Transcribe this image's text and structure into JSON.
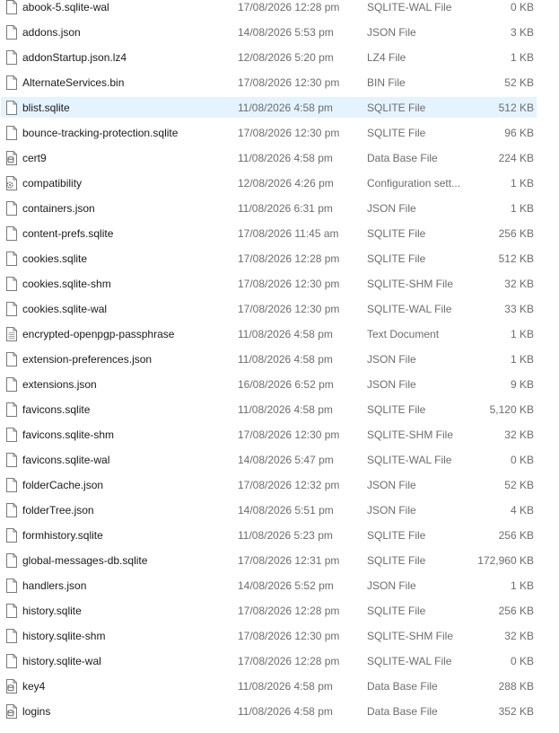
{
  "files": [
    {
      "name": "abook-5.sqlite-wal",
      "date": "17/08/2026 12:28 pm",
      "type": "SQLITE-WAL File",
      "size": "0 KB",
      "icon": "file-icon"
    },
    {
      "name": "addons.json",
      "date": "14/08/2026 5:53 pm",
      "type": "JSON File",
      "size": "3 KB",
      "icon": "file-icon"
    },
    {
      "name": "addonStartup.json.lz4",
      "date": "12/08/2026 5:20 pm",
      "type": "LZ4 File",
      "size": "1 KB",
      "icon": "file-icon"
    },
    {
      "name": "AlternateServices.bin",
      "date": "17/08/2026 12:30 pm",
      "type": "BIN File",
      "size": "52 KB",
      "icon": "file-icon"
    },
    {
      "name": "blist.sqlite",
      "date": "11/08/2026 4:58 pm",
      "type": "SQLITE File",
      "size": "512 KB",
      "icon": "file-icon",
      "selected": true
    },
    {
      "name": "bounce-tracking-protection.sqlite",
      "date": "17/08/2026 12:30 pm",
      "type": "SQLITE File",
      "size": "96 KB",
      "icon": "file-icon"
    },
    {
      "name": "cert9",
      "date": "11/08/2026 4:58 pm",
      "type": "Data Base File",
      "size": "224 KB",
      "icon": "database-file-icon"
    },
    {
      "name": "compatibility",
      "date": "12/08/2026 4:26 pm",
      "type": "Configuration sett...",
      "size": "1 KB",
      "icon": "settings-file-icon"
    },
    {
      "name": "containers.json",
      "date": "11/08/2026 6:31 pm",
      "type": "JSON File",
      "size": "1 KB",
      "icon": "file-icon"
    },
    {
      "name": "content-prefs.sqlite",
      "date": "17/08/2026 11:45 am",
      "type": "SQLITE File",
      "size": "256 KB",
      "icon": "file-icon"
    },
    {
      "name": "cookies.sqlite",
      "date": "17/08/2026 12:28 pm",
      "type": "SQLITE File",
      "size": "512 KB",
      "icon": "file-icon"
    },
    {
      "name": "cookies.sqlite-shm",
      "date": "17/08/2026 12:30 pm",
      "type": "SQLITE-SHM File",
      "size": "32 KB",
      "icon": "file-icon"
    },
    {
      "name": "cookies.sqlite-wal",
      "date": "17/08/2026 12:30 pm",
      "type": "SQLITE-WAL File",
      "size": "33 KB",
      "icon": "file-icon"
    },
    {
      "name": "encrypted-openpgp-passphrase",
      "date": "11/08/2026 4:58 pm",
      "type": "Text Document",
      "size": "1 KB",
      "icon": "text-file-icon"
    },
    {
      "name": "extension-preferences.json",
      "date": "11/08/2026 4:58 pm",
      "type": "JSON File",
      "size": "1 KB",
      "icon": "file-icon"
    },
    {
      "name": "extensions.json",
      "date": "16/08/2026 6:52 pm",
      "type": "JSON File",
      "size": "9 KB",
      "icon": "file-icon"
    },
    {
      "name": "favicons.sqlite",
      "date": "11/08/2026 4:58 pm",
      "type": "SQLITE File",
      "size": "5,120 KB",
      "icon": "file-icon"
    },
    {
      "name": "favicons.sqlite-shm",
      "date": "17/08/2026 12:30 pm",
      "type": "SQLITE-SHM File",
      "size": "32 KB",
      "icon": "file-icon"
    },
    {
      "name": "favicons.sqlite-wal",
      "date": "14/08/2026 5:47 pm",
      "type": "SQLITE-WAL File",
      "size": "0 KB",
      "icon": "file-icon"
    },
    {
      "name": "folderCache.json",
      "date": "17/08/2026 12:32 pm",
      "type": "JSON File",
      "size": "52 KB",
      "icon": "file-icon"
    },
    {
      "name": "folderTree.json",
      "date": "14/08/2026 5:51 pm",
      "type": "JSON File",
      "size": "4 KB",
      "icon": "file-icon"
    },
    {
      "name": "formhistory.sqlite",
      "date": "11/08/2026 5:23 pm",
      "type": "SQLITE File",
      "size": "256 KB",
      "icon": "file-icon"
    },
    {
      "name": "global-messages-db.sqlite",
      "date": "17/08/2026 12:31 pm",
      "type": "SQLITE File",
      "size": "172,960 KB",
      "icon": "file-icon"
    },
    {
      "name": "handlers.json",
      "date": "14/08/2026 5:52 pm",
      "type": "JSON File",
      "size": "1 KB",
      "icon": "file-icon"
    },
    {
      "name": "history.sqlite",
      "date": "17/08/2026 12:28 pm",
      "type": "SQLITE File",
      "size": "256 KB",
      "icon": "file-icon"
    },
    {
      "name": "history.sqlite-shm",
      "date": "17/08/2026 12:30 pm",
      "type": "SQLITE-SHM File",
      "size": "32 KB",
      "icon": "file-icon"
    },
    {
      "name": "history.sqlite-wal",
      "date": "17/08/2026 12:28 pm",
      "type": "SQLITE-WAL File",
      "size": "0 KB",
      "icon": "file-icon"
    },
    {
      "name": "key4",
      "date": "11/08/2026 4:58 pm",
      "type": "Data Base File",
      "size": "288 KB",
      "icon": "database-file-icon"
    },
    {
      "name": "logins",
      "date": "11/08/2026 4:58 pm",
      "type": "Data Base File",
      "size": "352 KB",
      "icon": "database-file-icon"
    }
  ],
  "colors": {
    "selected_row": "#e5f3ff",
    "primary_text": "#1a1a1a",
    "secondary_text": "#6d6d6d"
  }
}
